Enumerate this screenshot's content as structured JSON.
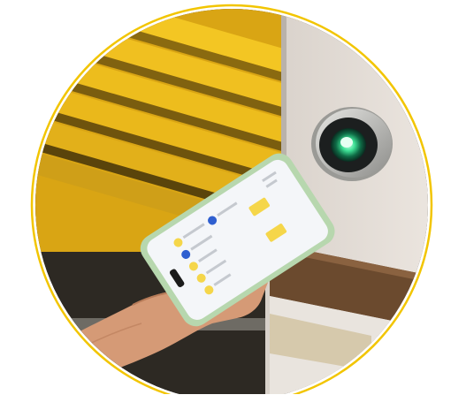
{
  "image": {
    "subject": "hand-holding-smartphone-near-access-reader",
    "frame_shape": "circle",
    "ring_color": "#F2C500",
    "colors": {
      "wall_yellow": "#F0BE1E",
      "wall_dark": "#2A2620",
      "door_panel": "#E7E1DA",
      "wood_trim": "#6B4A2E",
      "reader_ring": "#B8B8B5",
      "reader_led": "#35E08A",
      "phone_case": "#B7D7AE",
      "phone_screen": "#F4F6F9",
      "skin": "#D9A07C"
    }
  },
  "phone_app": {
    "accent": "#F5D64A",
    "item_count_shown": 6
  }
}
